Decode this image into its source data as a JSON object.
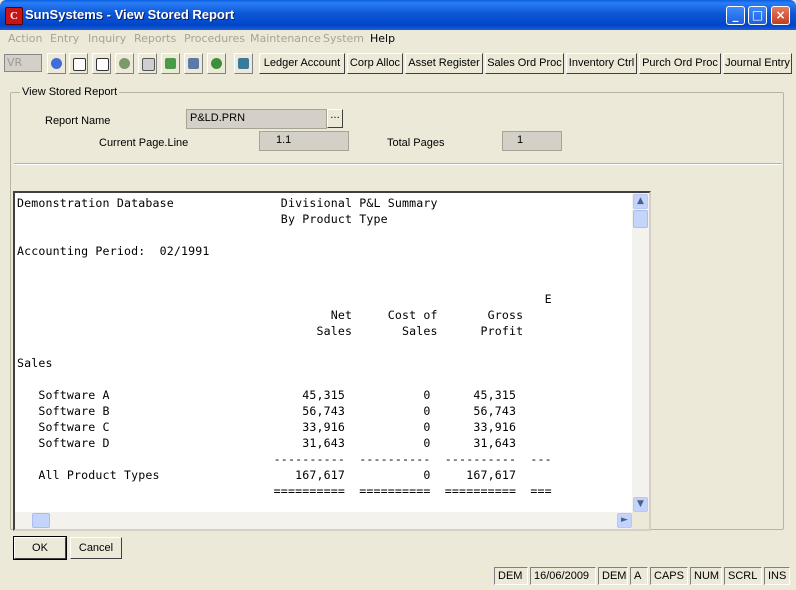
{
  "window": {
    "title": "SunSystems - View Stored Report",
    "app_icon_letter": "C",
    "controls": {
      "minimize": "_",
      "maximize": "□",
      "close": "×"
    }
  },
  "menu": [
    {
      "label": "Action",
      "enabled": false
    },
    {
      "label": "Entry",
      "enabled": false
    },
    {
      "label": "Inquiry",
      "enabled": false
    },
    {
      "label": "Reports",
      "enabled": false
    },
    {
      "label": "Procedures",
      "enabled": false
    },
    {
      "label": "Maintenance",
      "enabled": false
    },
    {
      "label": "System",
      "enabled": false
    },
    {
      "label": "Help",
      "enabled": true
    }
  ],
  "toolbar": {
    "ledger_code": "VR",
    "icons": [
      "help-icon",
      "open-icon",
      "copy-icon",
      "settings-icon",
      "edit-icon",
      "download-icon",
      "calculator-icon",
      "info-icon",
      "print-icon"
    ],
    "buttons": [
      "Ledger Account",
      "Corp Alloc",
      "Asset Register",
      "Sales Ord Proc",
      "Inventory Ctrl",
      "Purch Ord Proc",
      "Journal Entry"
    ]
  },
  "form": {
    "group_label": "View Stored Report",
    "report_name_label": "Report Name",
    "report_name_value": "P&LD.PRN",
    "ellipsis": "...",
    "current_page_label": "Current Page.Line",
    "current_page_value": "1.1",
    "total_pages_label": "Total Pages",
    "total_pages_value": "1"
  },
  "report": {
    "lines": [
      "Demonstration Database               Divisional P&L Summary",
      "                                     By Product Type",
      "",
      "Accounting Period:  02/1991",
      "",
      "",
      "                                                                          E",
      "                                            Net     Cost of       Gross",
      "                                          Sales       Sales      Profit",
      "",
      "Sales",
      "",
      "   Software A                           45,315           0      45,315",
      "   Software B                           56,743           0      56,743",
      "   Software C                           33,916           0      33,916",
      "   Software D                           31,643           0      31,643",
      "                                    ----------  ----------  ----------  ---",
      "   All Product Types                   167,617           0     167,617",
      "                                    ==========  ==========  ==========  ==="
    ]
  },
  "buttons": {
    "ok": "OK",
    "cancel": "Cancel"
  },
  "status": [
    "DEM",
    "16/06/2009",
    "DEM",
    "A",
    "CAPS",
    "NUM",
    "SCRL",
    "INS"
  ]
}
